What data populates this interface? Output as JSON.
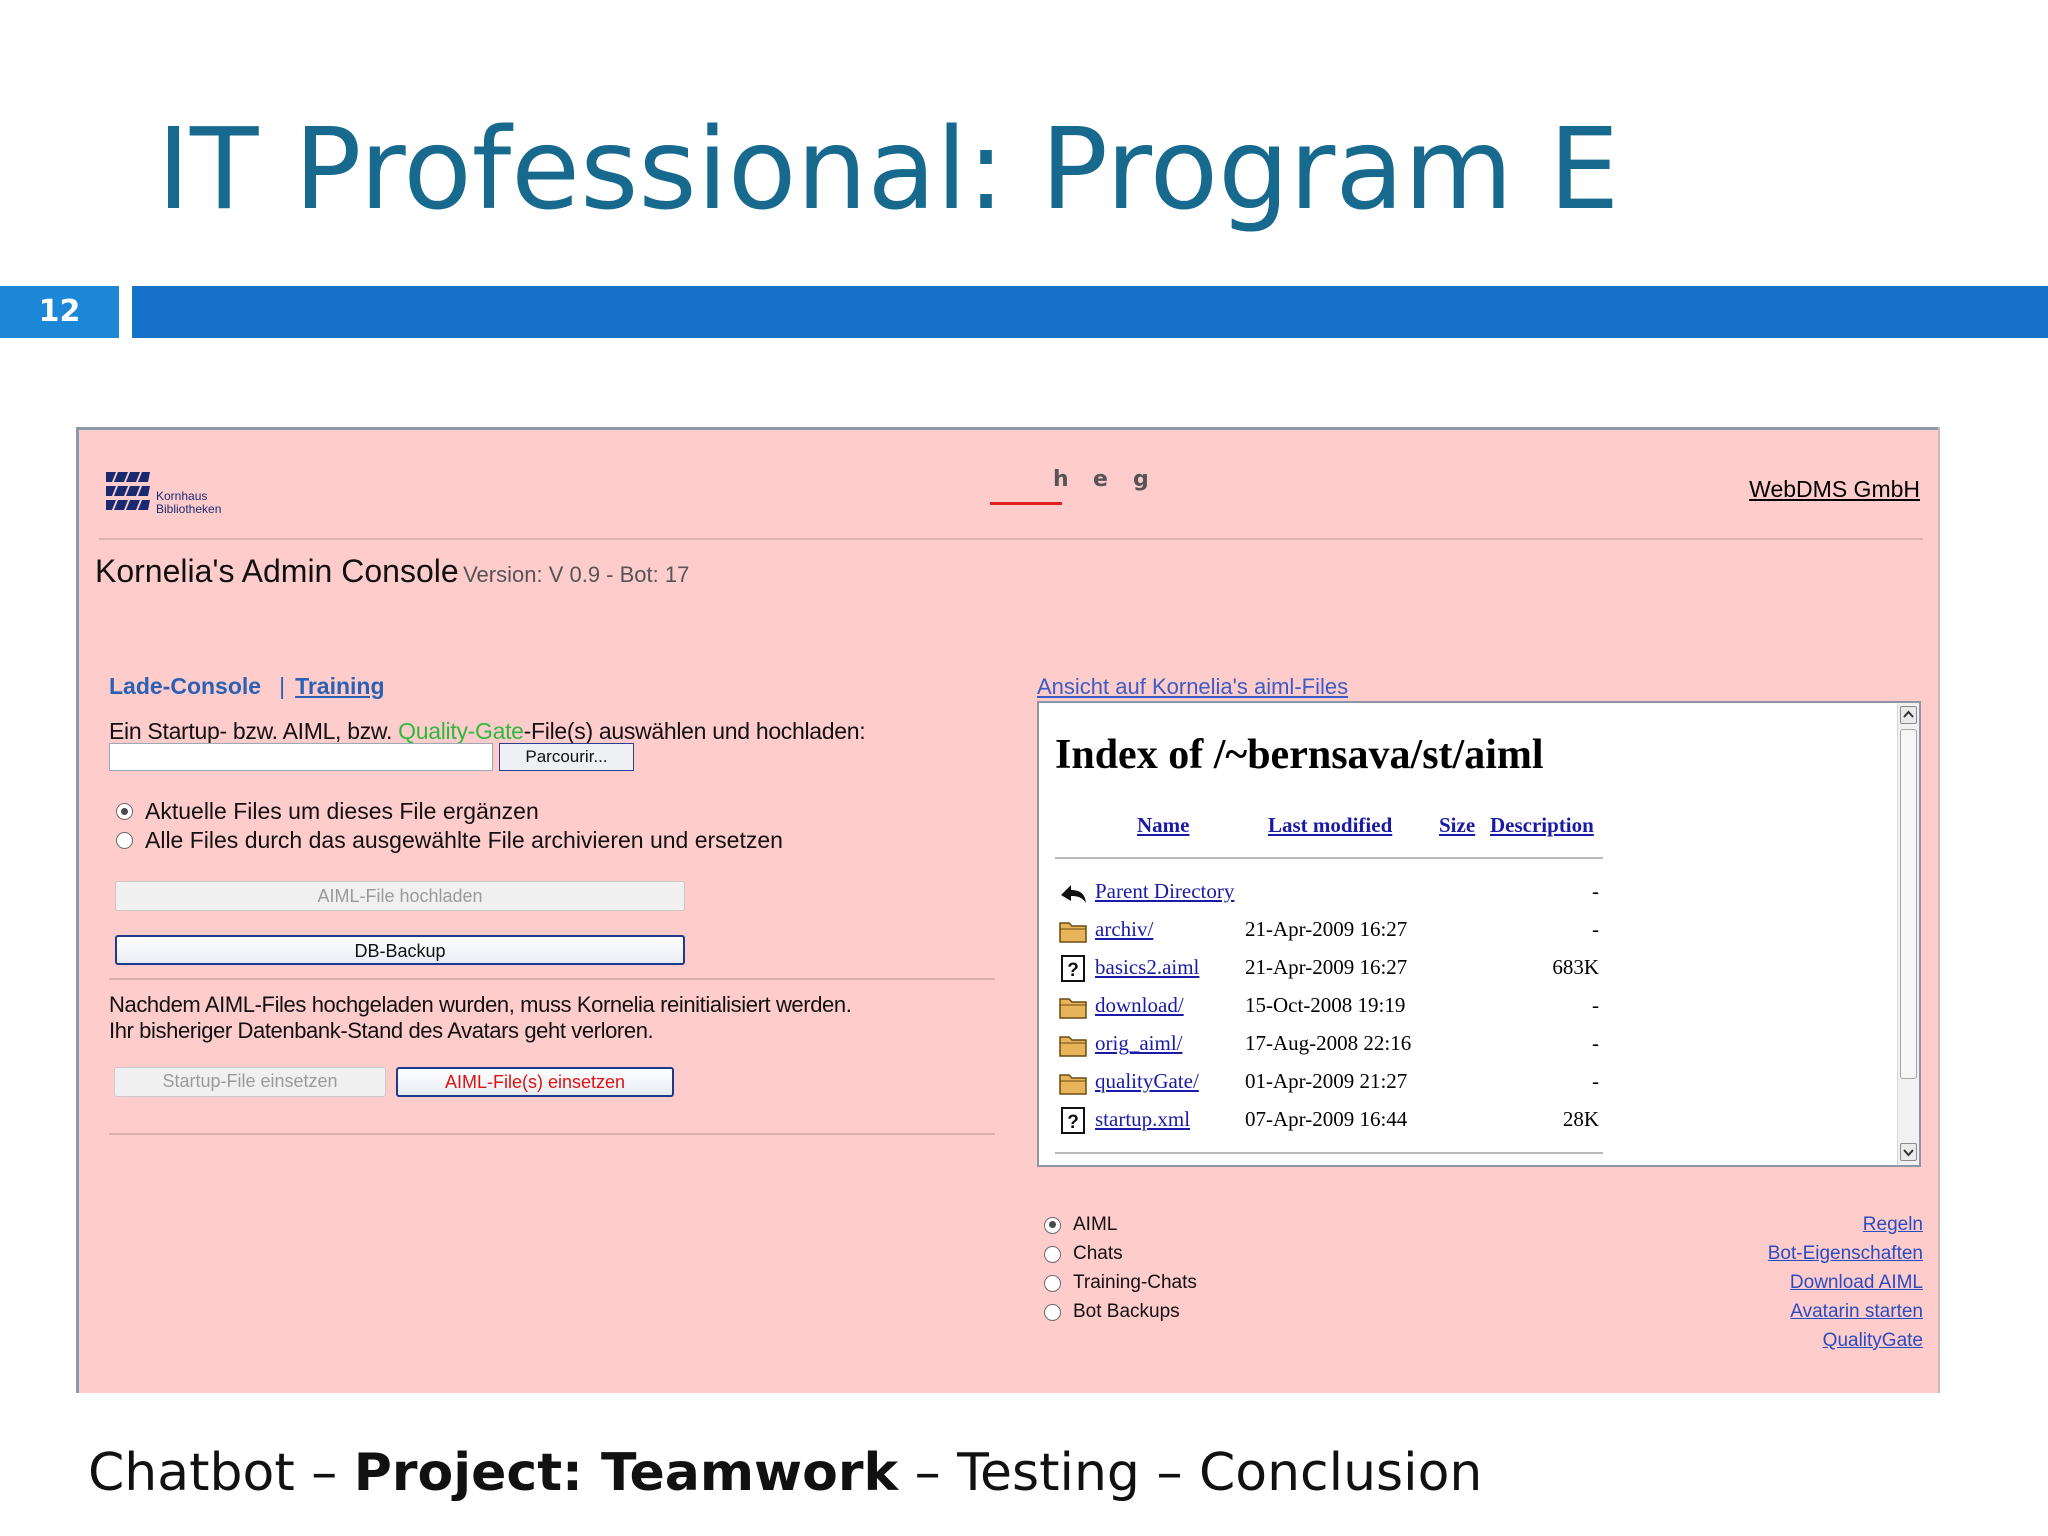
{
  "slide": {
    "title": "IT Professional: Program E",
    "page_number": "12",
    "nav": {
      "before": "Chatbot – ",
      "current": "Project: Teamwork",
      "after": " – Testing – Conclusion"
    }
  },
  "app": {
    "logo_text_line1": "Kornhaus",
    "logo_text_line2": "Bibliotheken",
    "heg_letters": [
      "h",
      "e",
      "g"
    ],
    "company_link": "WebDMS GmbH",
    "console_title": "Kornelia's Admin Console",
    "console_version": "Version: V 0.9 - Bot: 17",
    "left": {
      "tab_lade": "Lade-Console",
      "tab_separator": "|",
      "tab_training": "Training",
      "upload_label_before": "Ein Startup- bzw. AIML, bzw. ",
      "upload_label_qg": "Quality-Gate",
      "upload_label_after": "-File(s) auswählen und hochladen:",
      "file_input_value": "",
      "browse_button": "Parcourir...",
      "radio_add": "Aktuelle Files um dieses File ergänzen",
      "radio_replace": "Alle Files durch das ausgewählte File archivieren und ersetzen",
      "upload_button": "AIML-File hochladen",
      "backup_button": "DB-Backup",
      "notice_line1": "Nachdem AIML-Files hochgeladen wurden, muss Kornelia reinitialisiert werden.",
      "notice_line2": "Ihr bisheriger Datenbank-Stand des Avatars geht verloren.",
      "startup_button": "Startup-File einsetzen",
      "aiml_button": "AIML-File(s) einsetzen"
    },
    "right": {
      "files_link": "Ansicht auf Kornelia's aiml-Files",
      "index_title": "Index of /~bernsava/st/aiml",
      "columns": {
        "name": "Name",
        "modified": "Last modified",
        "size": "Size",
        "description": "Description"
      },
      "rows": [
        {
          "icon": "back-icon",
          "name": "Parent Directory",
          "date": "",
          "size": "-"
        },
        {
          "icon": "folder-icon",
          "name": "archiv/",
          "date": "21-Apr-2009 16:27",
          "size": "-"
        },
        {
          "icon": "unknown-file-icon",
          "name": "basics2.aiml",
          "date": "21-Apr-2009 16:27",
          "size": "683K"
        },
        {
          "icon": "folder-icon",
          "name": "download/",
          "date": "15-Oct-2008 19:19",
          "size": "-"
        },
        {
          "icon": "folder-icon",
          "name": "orig_aiml/",
          "date": "17-Aug-2008 22:16",
          "size": "-"
        },
        {
          "icon": "folder-icon",
          "name": "qualityGate/",
          "date": "01-Apr-2009 21:27",
          "size": "-"
        },
        {
          "icon": "unknown-file-icon",
          "name": "startup.xml",
          "date": "07-Apr-2009 16:44",
          "size": "28K"
        }
      ],
      "options": [
        "AIML",
        "Chats",
        "Training-Chats",
        "Bot Backups"
      ],
      "selected_option": "AIML",
      "links": [
        "Regeln",
        "Bot-Eigenschaften",
        "Download AIML",
        "Avatarin starten",
        "QualityGate"
      ]
    }
  },
  "colors": {
    "title": "#17698e",
    "bar_blue": "#1570c9",
    "page_number_bg": "#1b87d6",
    "app_background": "#ffcccc",
    "link_blue": "#2a61b4",
    "quality_gate_green": "#2eb840",
    "aiml_button_red": "#e01010"
  }
}
